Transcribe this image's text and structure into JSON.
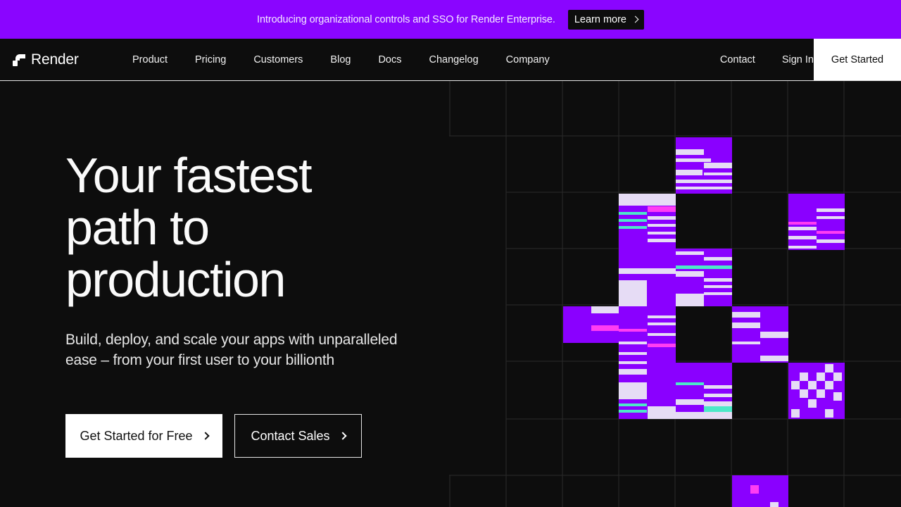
{
  "banner": {
    "text": "Introducing organizational controls and SSO for Render Enterprise.",
    "button_label": "Learn more"
  },
  "nav": {
    "brand": "Render",
    "links": [
      "Product",
      "Pricing",
      "Customers",
      "Blog",
      "Docs",
      "Changelog",
      "Company"
    ],
    "contact": "Contact",
    "signin": "Sign In",
    "cta": "Get Started"
  },
  "hero": {
    "title_lines": [
      "Your fastest",
      "path to",
      "production"
    ],
    "subtitle_lines": [
      "Build, deploy, and scale your apps with unparalleled",
      "ease – from your first user to your billionth"
    ],
    "primary_button": "Get Started for Free",
    "secondary_button": "Contact Sales"
  },
  "colors": {
    "accent": "#8a05ff",
    "background": "#0d0d0d",
    "tile_purple": "#8a00ff",
    "tile_light": "#e6dcf5",
    "tile_pink": "#ff3df2",
    "tile_teal": "#4ce8c8"
  }
}
